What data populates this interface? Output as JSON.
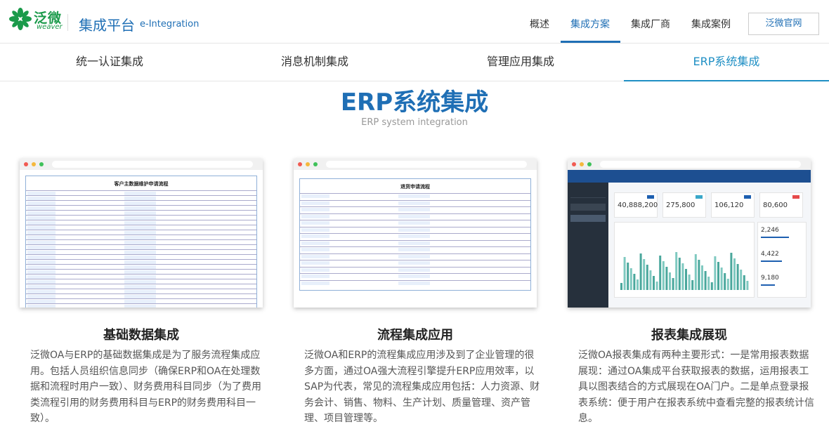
{
  "brand": {
    "logo_cn": "泛微",
    "logo_en": "weaver",
    "platform": "集成平台",
    "platform_en": "e-Integration"
  },
  "topnav": [
    "概述",
    "集成方案",
    "集成厂商",
    "集成案例"
  ],
  "site_button": "泛微官网",
  "tabs": [
    "统一认证集成",
    "消息机制集成",
    "管理应用集成",
    "ERP系统集成"
  ],
  "section": {
    "title": "ERP系统集成",
    "subtitle": "ERP system integration"
  },
  "cards": [
    {
      "title": "基础数据集成",
      "text": "泛微OA与ERP的基础数据集成是为了服务流程集成应用。包括人员组织信息同步（确保ERP和OA在处理数据和流程时用户一致）、财务费用科目同步（为了费用类流程引用的财务费用科目与ERP的财务费用科目一致）。",
      "mock_title": "客户主数据维护申请流程"
    },
    {
      "title": "流程集成应用",
      "text": "泛微OA和ERP的流程集成应用涉及到了企业管理的很多方面，通过OA强大流程引擎提升ERP应用效率，以SAP为代表，常见的流程集成应用包括：人力资源、财务会计、销售、物料、生产计划、质量管理、资产管理、项目管理等。",
      "mock_title": "退货申请流程"
    },
    {
      "title": "报表集成展现",
      "text": "泛微OA报表集成有两种主要形式：一是常用报表数据展现：通过OA集成平台获取报表的数据，运用报表工具以图表结合的方式展现在OA门户。二是单点登录报表系统：便于用户在报表系统中查看完整的报表统计信息。",
      "kpis": [
        "40,888,200",
        "275,800",
        "106,120",
        "80,600"
      ],
      "side_numbers": [
        "2,246",
        "4,422",
        "9,180"
      ]
    }
  ],
  "colors": {
    "brand_blue": "#1f6fb5",
    "active_tab": "#1f8fc4",
    "logo_green": "#1a9a4a"
  }
}
